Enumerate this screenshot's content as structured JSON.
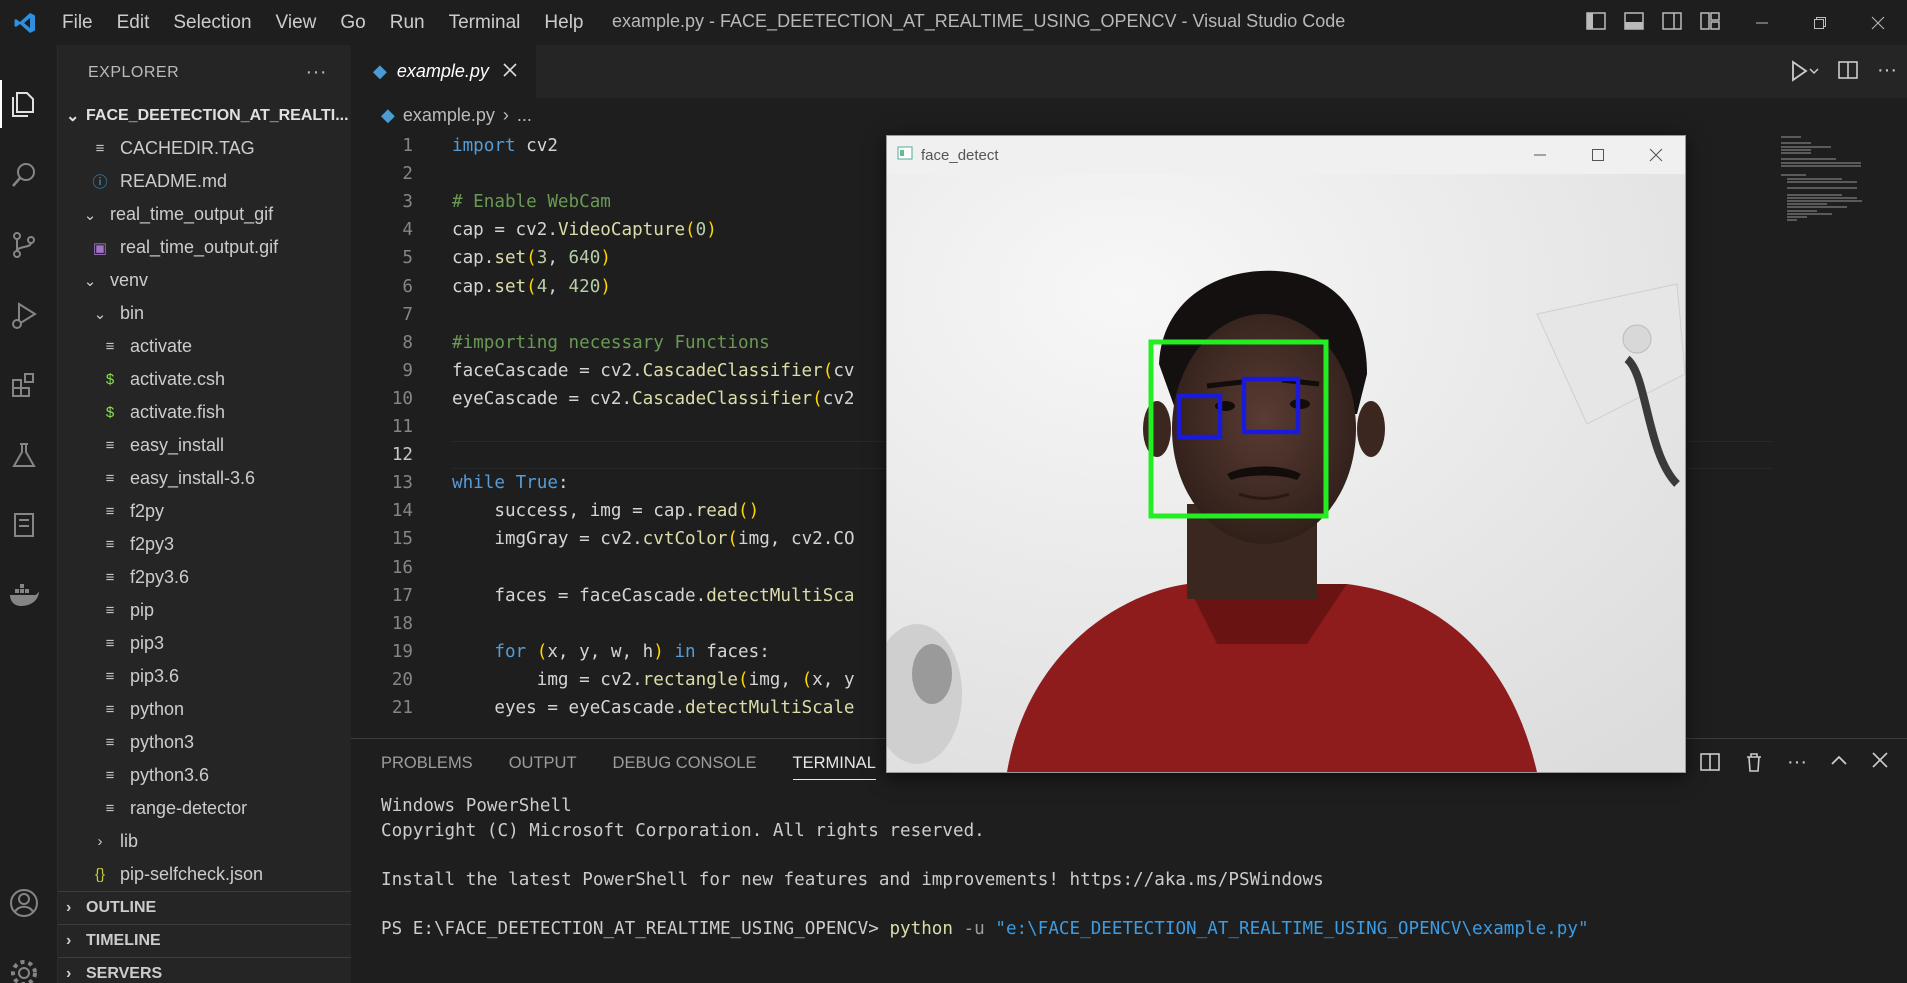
{
  "app": {
    "window_title": "example.py - FACE_DEETECTION_AT_REALTIME_USING_OPENCV - Visual Studio Code",
    "menu": [
      "File",
      "Edit",
      "Selection",
      "View",
      "Go",
      "Run",
      "Terminal",
      "Help"
    ],
    "accent_color": "#007acc"
  },
  "activity_bar": {
    "items": [
      "explorer-icon",
      "search-icon",
      "source-control-icon",
      "run-debug-icon",
      "extensions-icon",
      "testing-icon",
      "notebook-icon",
      "docker-icon"
    ],
    "bottom": [
      "account-icon",
      "settings-gear-icon"
    ]
  },
  "sidebar": {
    "title": "EXPLORER",
    "more": "···",
    "folder": "FACE_DEETECTION_AT_REALTI...",
    "items": [
      {
        "label": "CACHEDIR.TAG",
        "icon": "≡"
      },
      {
        "label": "README.md",
        "icon": "ⓘ"
      },
      {
        "label": "real_time_output_gif",
        "icon": "⌄"
      },
      {
        "label": "real_time_output.gif",
        "icon": "▣"
      },
      {
        "label": "venv",
        "icon": "⌄"
      },
      {
        "label": "bin",
        "icon": "⌄"
      },
      {
        "label": "activate",
        "icon": "≡"
      },
      {
        "label": "activate.csh",
        "icon": "$"
      },
      {
        "label": "activate.fish",
        "icon": "$"
      },
      {
        "label": "easy_install",
        "icon": "≡"
      },
      {
        "label": "easy_install-3.6",
        "icon": "≡"
      },
      {
        "label": "f2py",
        "icon": "≡"
      },
      {
        "label": "f2py3",
        "icon": "≡"
      },
      {
        "label": "f2py3.6",
        "icon": "≡"
      },
      {
        "label": "pip",
        "icon": "≡"
      },
      {
        "label": "pip3",
        "icon": "≡"
      },
      {
        "label": "pip3.6",
        "icon": "≡"
      },
      {
        "label": "python",
        "icon": "≡"
      },
      {
        "label": "python3",
        "icon": "≡"
      },
      {
        "label": "python3.6",
        "icon": "≡"
      },
      {
        "label": "range-detector",
        "icon": "≡"
      },
      {
        "label": "lib",
        "icon": "›"
      },
      {
        "label": "pip-selfcheck.json",
        "icon": "{}"
      }
    ],
    "sections": [
      "OUTLINE",
      "TIMELINE",
      "SERVERS"
    ]
  },
  "editor": {
    "tab": "example.py",
    "breadcrumb": [
      "example.py",
      "..."
    ],
    "current_line": 12,
    "lines": [
      {
        "n": "1",
        "code": "import cv2"
      },
      {
        "n": "2",
        "code": ""
      },
      {
        "n": "3",
        "code": "# Enable WebCam"
      },
      {
        "n": "4",
        "code": "cap = cv2.VideoCapture(0)"
      },
      {
        "n": "5",
        "code": "cap.set(3, 640)"
      },
      {
        "n": "6",
        "code": "cap.set(4, 420)"
      },
      {
        "n": "7",
        "code": ""
      },
      {
        "n": "8",
        "code": "#importing necessary Functions"
      },
      {
        "n": "9",
        "code": "faceCascade = cv2.CascadeClassifier(cv"
      },
      {
        "n": "10",
        "code": "eyeCascade = cv2.CascadeClassifier(cv2"
      },
      {
        "n": "11",
        "code": ""
      },
      {
        "n": "12",
        "code": ""
      },
      {
        "n": "13",
        "code": "while True:"
      },
      {
        "n": "14",
        "code": "    success, img = cap.read()"
      },
      {
        "n": "15",
        "code": "    imgGray = cv2.cvtColor(img, cv2.CO"
      },
      {
        "n": "16",
        "code": ""
      },
      {
        "n": "17",
        "code": "    faces = faceCascade.detectMultiSca"
      },
      {
        "n": "18",
        "code": ""
      },
      {
        "n": "19",
        "code": "    for (x, y, w, h) in faces:"
      },
      {
        "n": "20",
        "code": "        img = cv2.rectangle(img, (x, y"
      },
      {
        "n": "21",
        "code": "    eyes = eyeCascade.detectMultiScale"
      }
    ]
  },
  "panel": {
    "tabs": [
      "PROBLEMS",
      "OUTPUT",
      "DEBUG CONSOLE",
      "TERMINAL"
    ],
    "active_tab": "TERMINAL",
    "terminal": {
      "line1": "Windows PowerShell",
      "line2": "Copyright (C) Microsoft Corporation. All rights reserved.",
      "line3": "Install the latest PowerShell for new features and improvements! https://aka.ms/PSWindows",
      "prompt": "PS E:\\FACE_DEETECTION_AT_REALTIME_USING_OPENCV> ",
      "cmd": "python",
      "flag": " -u ",
      "arg": "\"e:\\FACE_DEETECTION_AT_REALTIME_USING_OPENCV\\example.py\""
    }
  },
  "face_window": {
    "title": "face_detect",
    "face_box_color": "#22ee22",
    "eye_box_color": "#1a1adc"
  }
}
